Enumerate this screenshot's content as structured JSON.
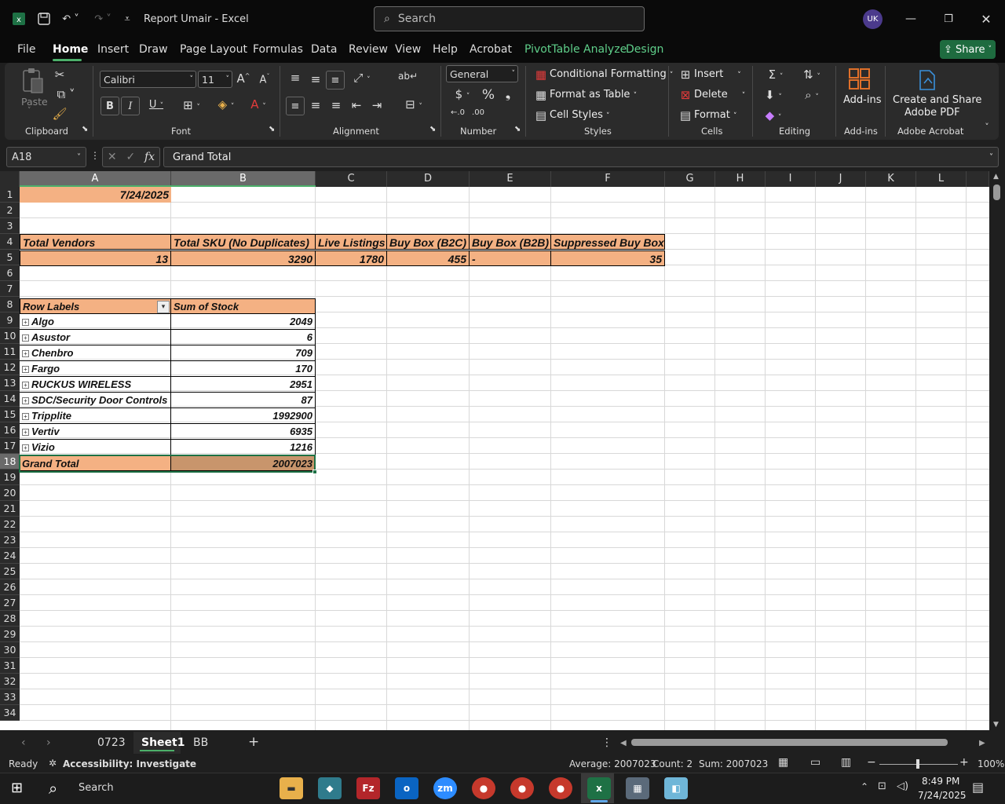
{
  "window": {
    "title": "Report Umair  -  Excel",
    "search_placeholder": "Search",
    "avatar_initials": "UK"
  },
  "menu": {
    "tabs": [
      "File",
      "Home",
      "Insert",
      "Draw",
      "Page Layout",
      "Formulas",
      "Data",
      "Review",
      "View",
      "Help",
      "Acrobat",
      "PivotTable Analyze",
      "Design"
    ],
    "active": "Home",
    "share_label": "Share"
  },
  "ribbon": {
    "clipboard": {
      "paste_label": "Paste",
      "group": "Clipboard"
    },
    "font": {
      "family": "Calibri",
      "size": "11",
      "group": "Font"
    },
    "alignment": {
      "group": "Alignment"
    },
    "number": {
      "format": "General",
      "group": "Number"
    },
    "styles": {
      "conditional": "Conditional Formatting",
      "format_table": "Format as Table",
      "cell_styles": "Cell Styles",
      "group": "Styles"
    },
    "cells": {
      "insert": "Insert",
      "delete": "Delete",
      "format": "Format",
      "group": "Cells"
    },
    "editing": {
      "group": "Editing"
    },
    "addins": {
      "label": "Add-ins",
      "group": "Add-ins"
    },
    "acrobat": {
      "label_1": "Create and Share",
      "label_2": "Adobe PDF",
      "group": "Adobe Acrobat"
    }
  },
  "formula_bar": {
    "name_box": "A18",
    "formula": "Grand Total"
  },
  "columns": [
    "A",
    "B",
    "C",
    "D",
    "E",
    "F",
    "G",
    "H",
    "I",
    "J",
    "K",
    "L"
  ],
  "rows": [
    "1",
    "2",
    "3",
    "4",
    "5",
    "6",
    "7",
    "8",
    "9",
    "10",
    "11",
    "12",
    "13",
    "14",
    "15",
    "16",
    "17",
    "18",
    "19",
    "20",
    "21",
    "22",
    "23",
    "24",
    "25",
    "26",
    "27",
    "28",
    "29",
    "30",
    "31",
    "32",
    "33",
    "34"
  ],
  "sheet": {
    "date": "7/24/2025",
    "summary_headers": [
      "Total Vendors",
      "Total SKU (No Duplicates)",
      "Live Listings",
      "Buy Box (B2C)",
      "Buy Box (B2B)",
      "Suppressed Buy Box"
    ],
    "summary_values": [
      "13",
      "3290",
      "1780",
      "455",
      "-",
      "35"
    ],
    "pivot_header_labels": "Row Labels",
    "pivot_header_values": "Sum of Stock",
    "pivot_rows": [
      {
        "label": "Algo",
        "value": "2049"
      },
      {
        "label": "Asustor",
        "value": "6"
      },
      {
        "label": "Chenbro",
        "value": "709"
      },
      {
        "label": "Fargo",
        "value": "170"
      },
      {
        "label": "RUCKUS WIRELESS",
        "value": "2951"
      },
      {
        "label": "SDC/Security Door Controls",
        "value": "87"
      },
      {
        "label": "Tripplite",
        "value": "1992900"
      },
      {
        "label": "Vertiv",
        "value": "6935"
      },
      {
        "label": "Vizio",
        "value": "1216"
      }
    ],
    "grand_total_label": "Grand Total",
    "grand_total_value": "2007023"
  },
  "sheet_tabs": {
    "tabs": [
      "0723",
      "Sheet1",
      "BB"
    ],
    "active": "Sheet1"
  },
  "status_bar": {
    "ready": "Ready",
    "accessibility": "Accessibility: Investigate",
    "average": "Average: 2007023",
    "count": "Count: 2",
    "sum": "Sum: 2007023",
    "zoom": "100%"
  },
  "taskbar": {
    "search": "Search",
    "time": "8:49 PM",
    "date": "7/24/2025"
  },
  "colors": {
    "accent_green": "#4caf6a",
    "header_fill": "#f4b183",
    "grand_total_fill": "#c8956c"
  }
}
